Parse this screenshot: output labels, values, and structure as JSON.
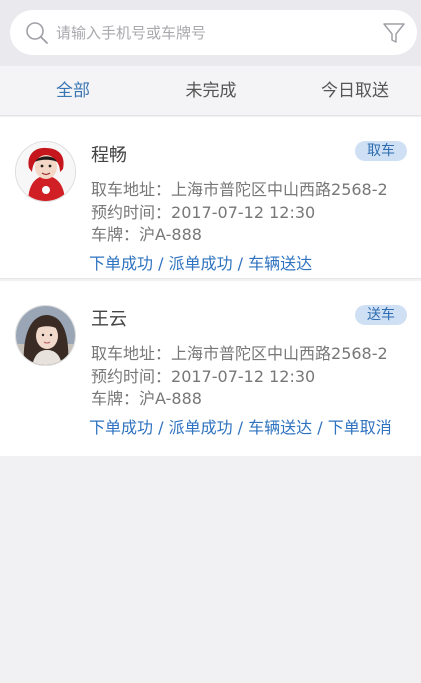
{
  "search": {
    "placeholder": "请输入手机号或车牌号",
    "search_icon": "search-icon",
    "filter_icon": "filter-icon"
  },
  "tabs": [
    {
      "label": "全部",
      "active": true
    },
    {
      "label": "未完成",
      "active": false
    },
    {
      "label": "今日取送",
      "active": false
    }
  ],
  "orders": [
    {
      "name": "程畅",
      "badge": "取车",
      "address_label": "取车地址：",
      "address": "上海市普陀区中山西路2568-2",
      "time_label": "预约时间：",
      "time": "2017-07-12  12:30",
      "plate_label": "车牌：",
      "plate": "沪A-888",
      "status": "下单成功 / 派单成功 / 车辆送达"
    },
    {
      "name": "王云",
      "badge": "送车",
      "address_label": "取车地址：",
      "address": "上海市普陀区中山西路2568-2",
      "time_label": "预约时间：",
      "time": "2017-07-12  12:30",
      "plate_label": "车牌：",
      "plate": "沪A-888",
      "status": "下单成功 / 派单成功 / 车辆送达 / 下单取消"
    }
  ],
  "colors": {
    "accent": "#2f73c0",
    "badge_bg": "#cfe0f5",
    "background": "#f1f1f4"
  }
}
